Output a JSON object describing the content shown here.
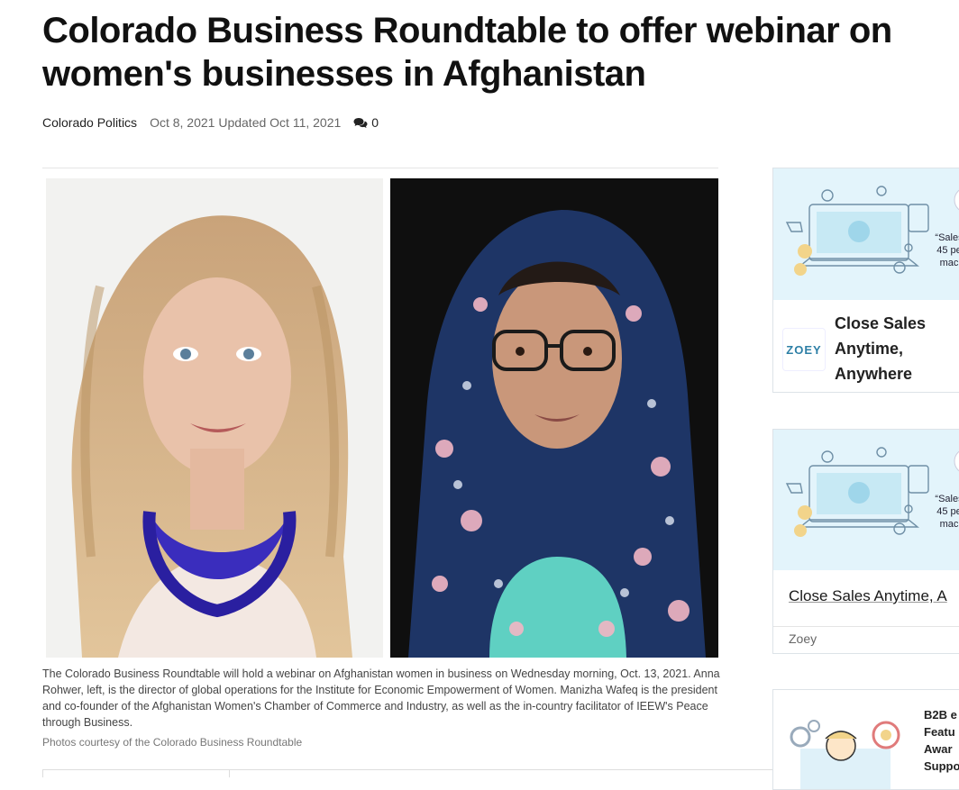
{
  "article": {
    "headline": "Colorado Business Roundtable to offer webinar on women's businesses in Afghanistan",
    "source": "Colorado Politics",
    "dates": "Oct 8, 2021 Updated Oct 11, 2021",
    "comment_count": "0",
    "caption": "The Colorado Business Roundtable will hold a webinar on Afghanistan women in business on Wednesday morning, Oct. 13, 2021. Anna Rohwer, left, is the director of global operations for the Institute for Economic Empowerment of Women. Manizha Wafeq is the president and co-founder of the Afghanistan Women's Chamber of Commerce and Industry, as well as the in-country facilitator of IEEW's Peace through Business.",
    "credit": "Photos courtesy of the Colorado Business Roundtable"
  },
  "ads": {
    "ad1": {
      "quote": "“Sales 45 pe mac",
      "logo_text": "ZOEY",
      "title": "Close Sales Anytime, Anywhere"
    },
    "ad2": {
      "quote": "“Sales 45 pe mac",
      "title": "Close Sales Anytime, A",
      "source": "Zoey"
    },
    "ad3": {
      "text": "B2B e Featu Awar Suppo"
    }
  },
  "colors": {
    "accent": "#2d7fa6",
    "ad_bg": "#e3f4fb",
    "necklace": "#3a2dbd"
  }
}
